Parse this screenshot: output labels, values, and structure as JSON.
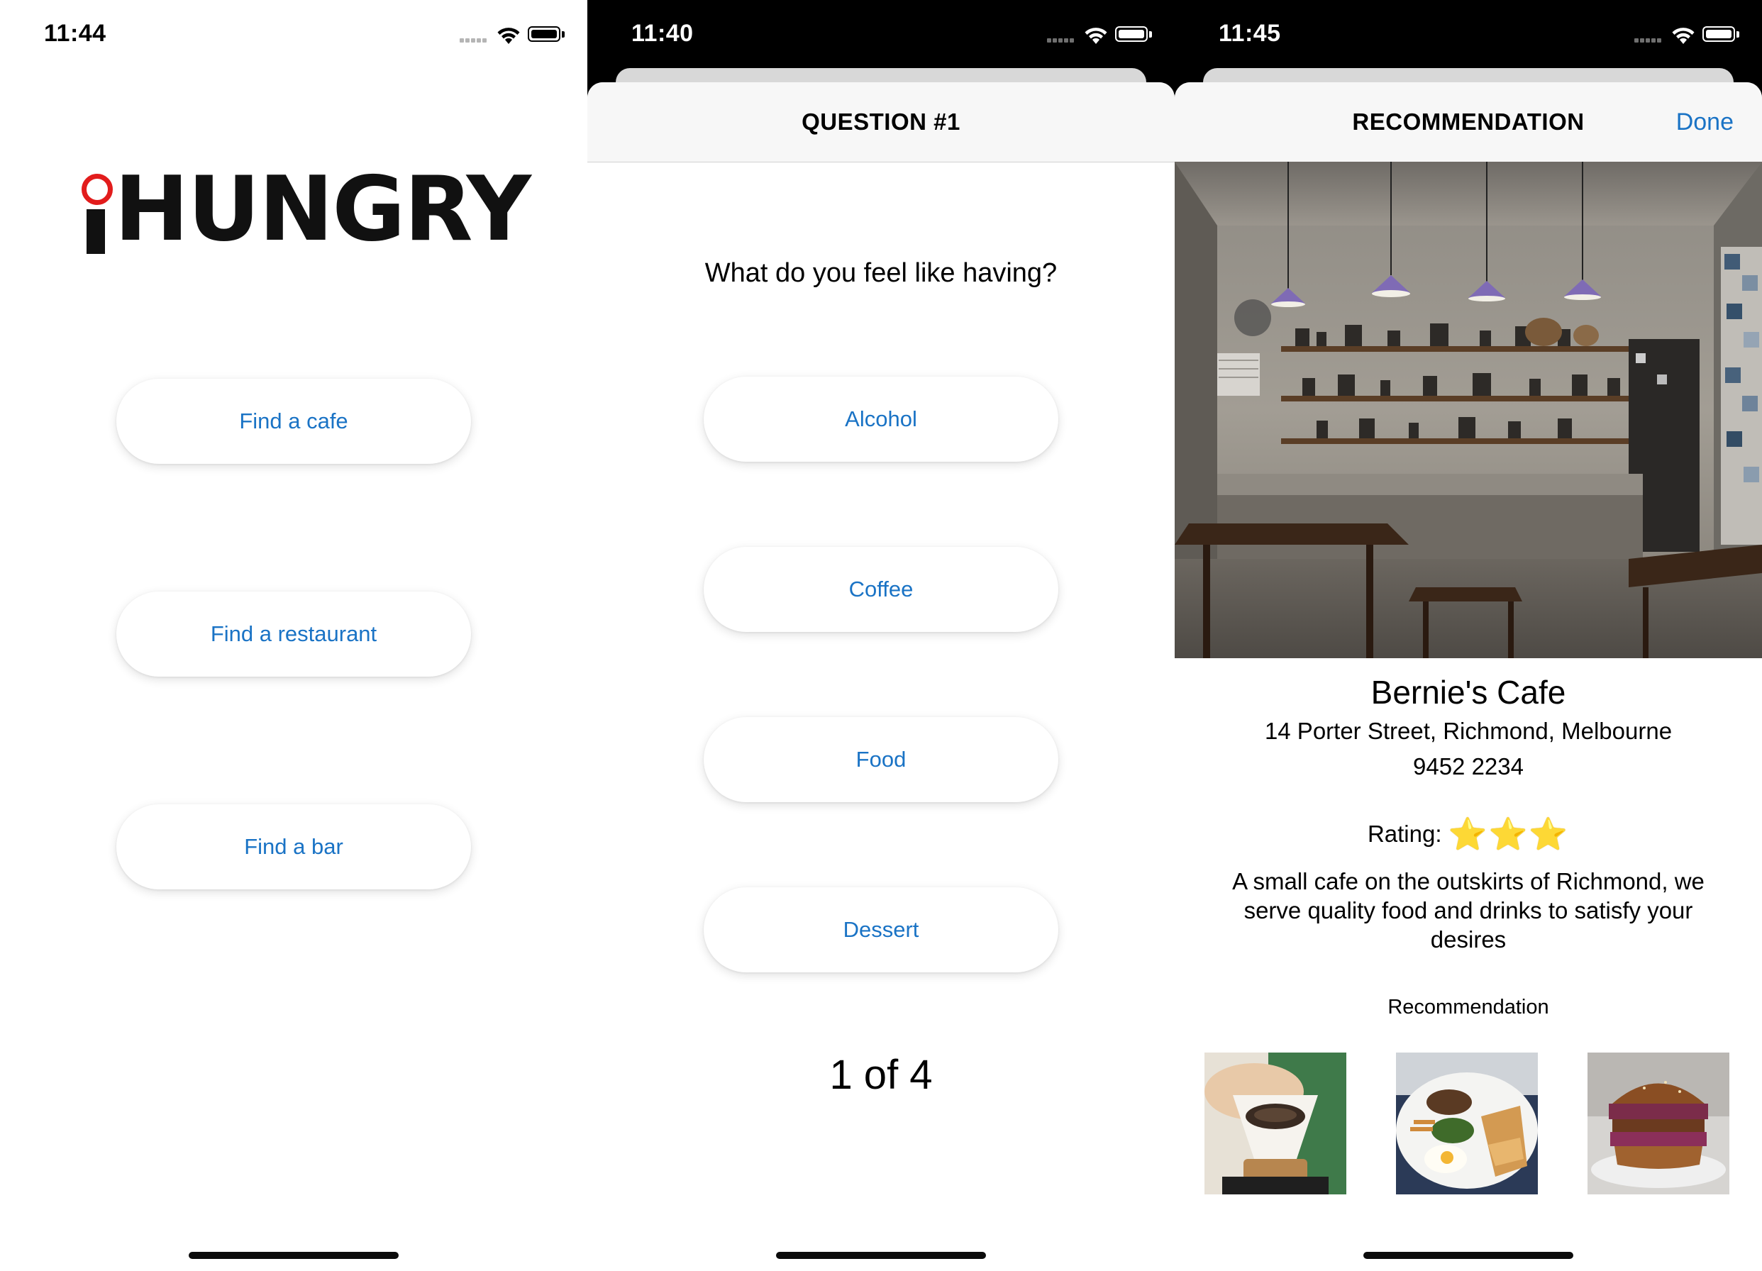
{
  "screen1": {
    "status": {
      "time": "11:44"
    },
    "logo": {
      "prefix": "i",
      "word": "HUNGRY",
      "accent": "#e21c1c"
    },
    "buttons": [
      "Find a cafe",
      "Find a restaurant",
      "Find a bar"
    ]
  },
  "screen2": {
    "status": {
      "time": "11:40"
    },
    "title": "QUESTION #1",
    "question": "What do you feel like having?",
    "options": [
      "Alcohol",
      "Coffee",
      "Food",
      "Dessert"
    ],
    "progress": "1 of 4"
  },
  "screen3": {
    "status": {
      "time": "11:45"
    },
    "title": "RECOMMENDATION",
    "done": "Done",
    "name": "Bernie's Cafe",
    "address": "14 Porter Street, Richmond, Melbourne",
    "phone": "9452 2234",
    "rating_label": "Rating:",
    "rating_stars": "⭐⭐⭐",
    "rating_value": 3,
    "description": "A small cafe on the outskirts of Richmond, we serve quality food and drinks to satisfy your desires",
    "recommendation_label": "Recommendation",
    "thumbnails": [
      "coffee-dripper",
      "breakfast-plate",
      "burger"
    ]
  },
  "colors": {
    "accent_blue": "#1a73c5",
    "brand_red": "#e21c1c"
  }
}
